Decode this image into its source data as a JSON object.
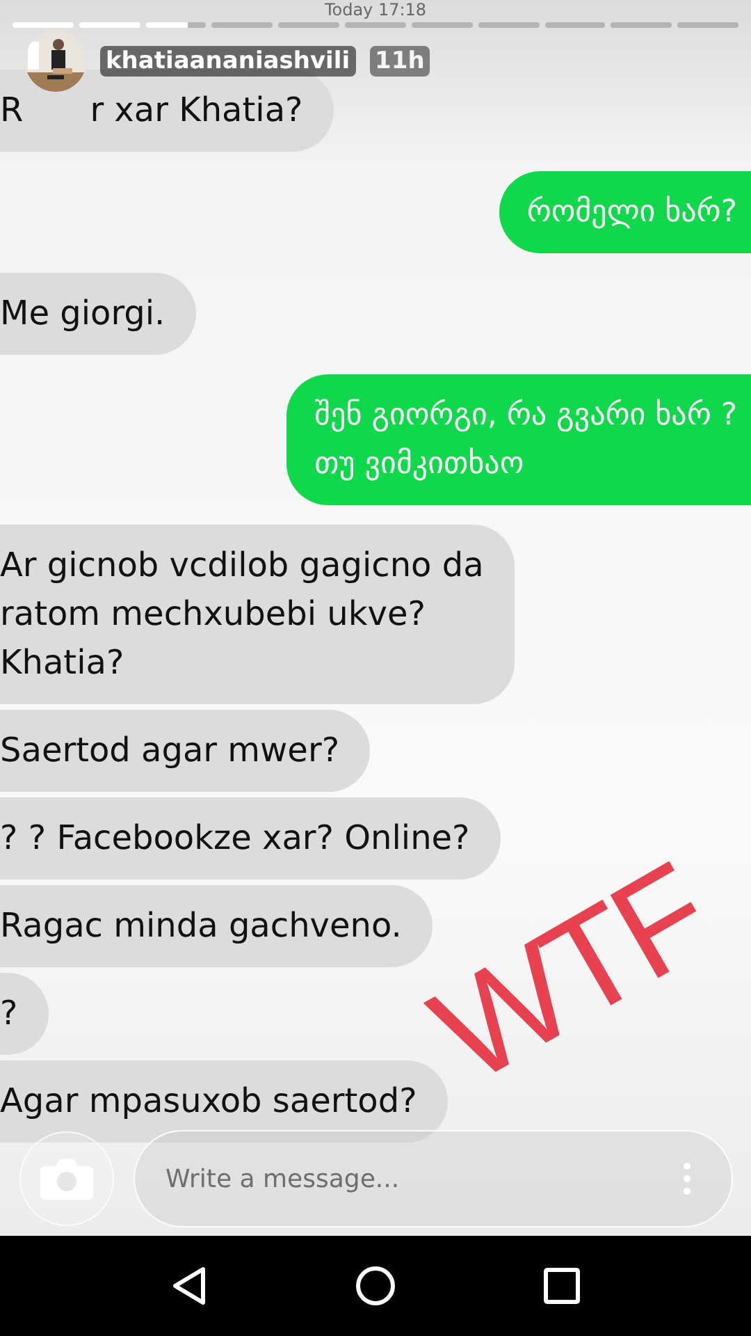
{
  "timestamp": "Today 17:18",
  "story_progress": [
    {
      "viewed": true,
      "selected": false
    },
    {
      "viewed": true,
      "selected": false
    },
    {
      "viewed": false,
      "selected": true
    },
    {
      "viewed": false,
      "selected": false
    },
    {
      "viewed": false,
      "selected": false
    },
    {
      "viewed": false,
      "selected": false
    },
    {
      "viewed": false,
      "selected": false
    },
    {
      "viewed": false,
      "selected": false
    },
    {
      "viewed": false,
      "selected": false
    },
    {
      "viewed": false,
      "selected": false
    },
    {
      "viewed": false,
      "selected": false
    }
  ],
  "story_header": {
    "username": "khatiaananiashvili",
    "time": "11h"
  },
  "messages": [
    {
      "kind": "received",
      "text": "R",
      "text_after": "r xar Khatia?"
    },
    {
      "kind": "sent",
      "text": "რომელი ხარ?"
    },
    {
      "kind": "received",
      "text": "Me giorgi."
    },
    {
      "kind": "sent",
      "text": "შენ გიორგი, რა გვარი ხარ ?\nთუ ვიმკითხაო"
    },
    {
      "kind": "received",
      "text": "Ar gicnob vcdilob gagicno da\nratom mechxubebi ukve?\nKhatia?"
    },
    {
      "kind": "received",
      "text": "Saertod agar mwer?"
    },
    {
      "kind": "received",
      "text": "? ? Facebookze xar? Online?"
    },
    {
      "kind": "received",
      "text": "Ragac minda gachveno."
    },
    {
      "kind": "received",
      "text": "?"
    },
    {
      "kind": "received",
      "text": "Agar mpasuxob saertod?"
    }
  ],
  "sticker": {
    "text": "WTF"
  },
  "composer": {
    "placeholder": "Write a message..."
  }
}
